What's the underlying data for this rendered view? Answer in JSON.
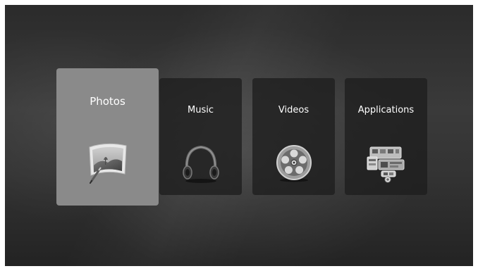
{
  "menu": {
    "items": [
      {
        "label": "Photos",
        "icon": "photo-frame-icon",
        "selected": true
      },
      {
        "label": "Music",
        "icon": "headphones-icon",
        "selected": false
      },
      {
        "label": "Videos",
        "icon": "film-reel-icon",
        "selected": false
      },
      {
        "label": "Applications",
        "icon": "app-windows-icon",
        "selected": false
      }
    ]
  },
  "colors": {
    "selected_tile": "#8a8a8a",
    "tile": "#1e1e1e",
    "background": "#333333",
    "text": "#ffffff"
  }
}
